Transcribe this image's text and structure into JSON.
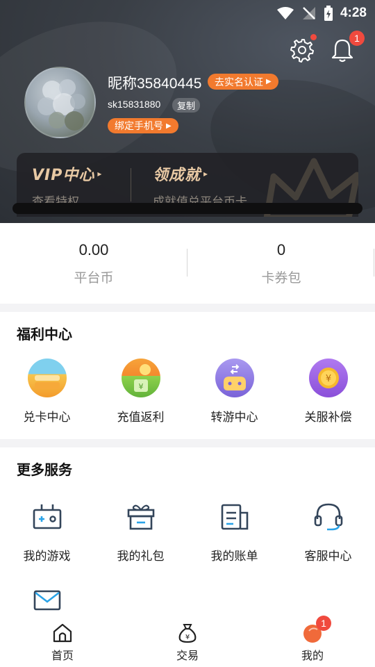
{
  "status_bar": {
    "time": "4:28"
  },
  "header": {
    "notification_count": "1",
    "nickname": "昵称35840445",
    "verify_label": "去实名认证",
    "account_id": "sk15831880",
    "copy_label": "复制",
    "bind_phone_label": "绑定手机号"
  },
  "vip_card": {
    "vip_title": "VIP中心",
    "vip_sub": "查看特权",
    "achievement_title": "领成就",
    "achievement_sub": "成就值兑平台币卡"
  },
  "wallet": [
    {
      "value": "0.00",
      "label": "平台币"
    },
    {
      "value": "0",
      "label": "卡券包"
    }
  ],
  "welfare": {
    "title": "福利中心",
    "items": [
      {
        "label": "兑卡中心",
        "icon": "card-exchange-icon"
      },
      {
        "label": "充值返利",
        "icon": "recharge-rebate-icon"
      },
      {
        "label": "转游中心",
        "icon": "game-transfer-icon"
      },
      {
        "label": "关服补偿",
        "icon": "server-compensation-icon"
      }
    ]
  },
  "services": {
    "title": "更多服务",
    "items": [
      {
        "label": "我的游戏",
        "icon": "game-console-icon"
      },
      {
        "label": "我的礼包",
        "icon": "gift-box-icon"
      },
      {
        "label": "我的账单",
        "icon": "bill-icon"
      },
      {
        "label": "客服中心",
        "icon": "headset-icon"
      }
    ],
    "extra_icon": "mail-icon"
  },
  "tabbar": {
    "items": [
      {
        "label": "首页",
        "icon": "home-icon"
      },
      {
        "label": "交易",
        "icon": "money-bag-icon"
      },
      {
        "label": "我的",
        "icon": "profile-icon"
      }
    ],
    "mine_badge": "1"
  },
  "colors": {
    "accent_orange": "#f27a2e",
    "badge_red": "#f04a3e",
    "vip_gold": "#e8c9a4",
    "service_icon_blue": "#33455a"
  }
}
